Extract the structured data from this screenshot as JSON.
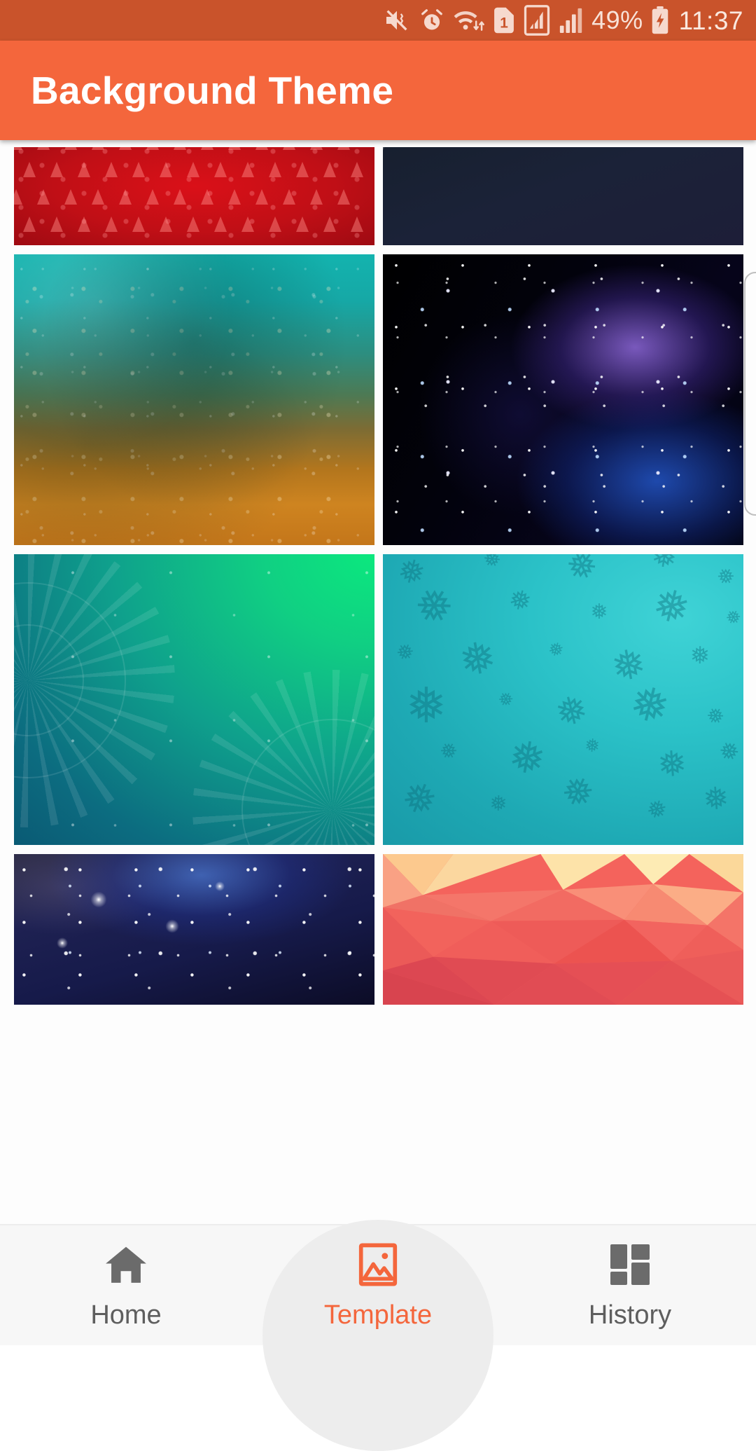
{
  "status_bar": {
    "background_color": "#C9532B",
    "icons": [
      {
        "name": "mute-vibrate-icon"
      },
      {
        "name": "alarm-clock-icon"
      },
      {
        "name": "wifi-transfer-icon"
      },
      {
        "name": "sim-card-icon",
        "label": "1"
      },
      {
        "name": "mobile-data-icon"
      },
      {
        "name": "signal-bars-icon"
      }
    ],
    "battery_percent": "49%",
    "battery_state": "charging",
    "clock": "11:37"
  },
  "app_bar": {
    "title": "Background Theme",
    "background_color": "#F4663C",
    "title_color": "#FFFFFF"
  },
  "grid": {
    "columns": 2,
    "items": [
      {
        "id": "theme-1",
        "name": "red-christmas-tree-pattern",
        "description": "Red background with repeating white christmas tree pattern",
        "primary_color": "#C00F16"
      },
      {
        "id": "theme-2",
        "name": "dark-navy-diagonal-streaks",
        "description": "Dark navy blue with faint diagonal light streaks",
        "primary_color": "#1B2238"
      },
      {
        "id": "theme-3",
        "name": "teal-orange-grunge-texture",
        "description": "Teal to orange speckled grunge gradient",
        "primary_color": "#16A8A6"
      },
      {
        "id": "theme-4",
        "name": "purple-blue-galaxy-nebula",
        "description": "Black space with purple and blue nebula and stars",
        "primary_color": "#06041A"
      },
      {
        "id": "theme-5",
        "name": "teal-green-mandala",
        "description": "Teal to green gradient with mandala line art",
        "primary_color": "#0FA08C"
      },
      {
        "id": "theme-6",
        "name": "turquoise-snowflake-pattern",
        "description": "Turquoise background with snowflake pattern",
        "primary_color": "#2BC2C8"
      },
      {
        "id": "theme-7",
        "name": "blue-starfield",
        "description": "Deep blue night sky with bright stars",
        "primary_color": "#1E2152"
      },
      {
        "id": "theme-8",
        "name": "coral-low-poly-triangles",
        "description": "Low poly geometric triangles in coral, red and yellow",
        "primary_color": "#F4635C"
      }
    ]
  },
  "side_sheet": {
    "name": "side-panel-edge",
    "visible": true
  },
  "bottom_nav": {
    "active_index": 1,
    "active_color": "#F4663C",
    "inactive_color": "#5E5E5E",
    "background_color": "#F7F7F7",
    "items": [
      {
        "label": "Home",
        "icon": "home-icon",
        "active": false
      },
      {
        "label": "Template",
        "icon": "image-picture-icon",
        "active": true
      },
      {
        "label": "History",
        "icon": "dashboard-grid-icon",
        "active": false
      }
    ]
  }
}
